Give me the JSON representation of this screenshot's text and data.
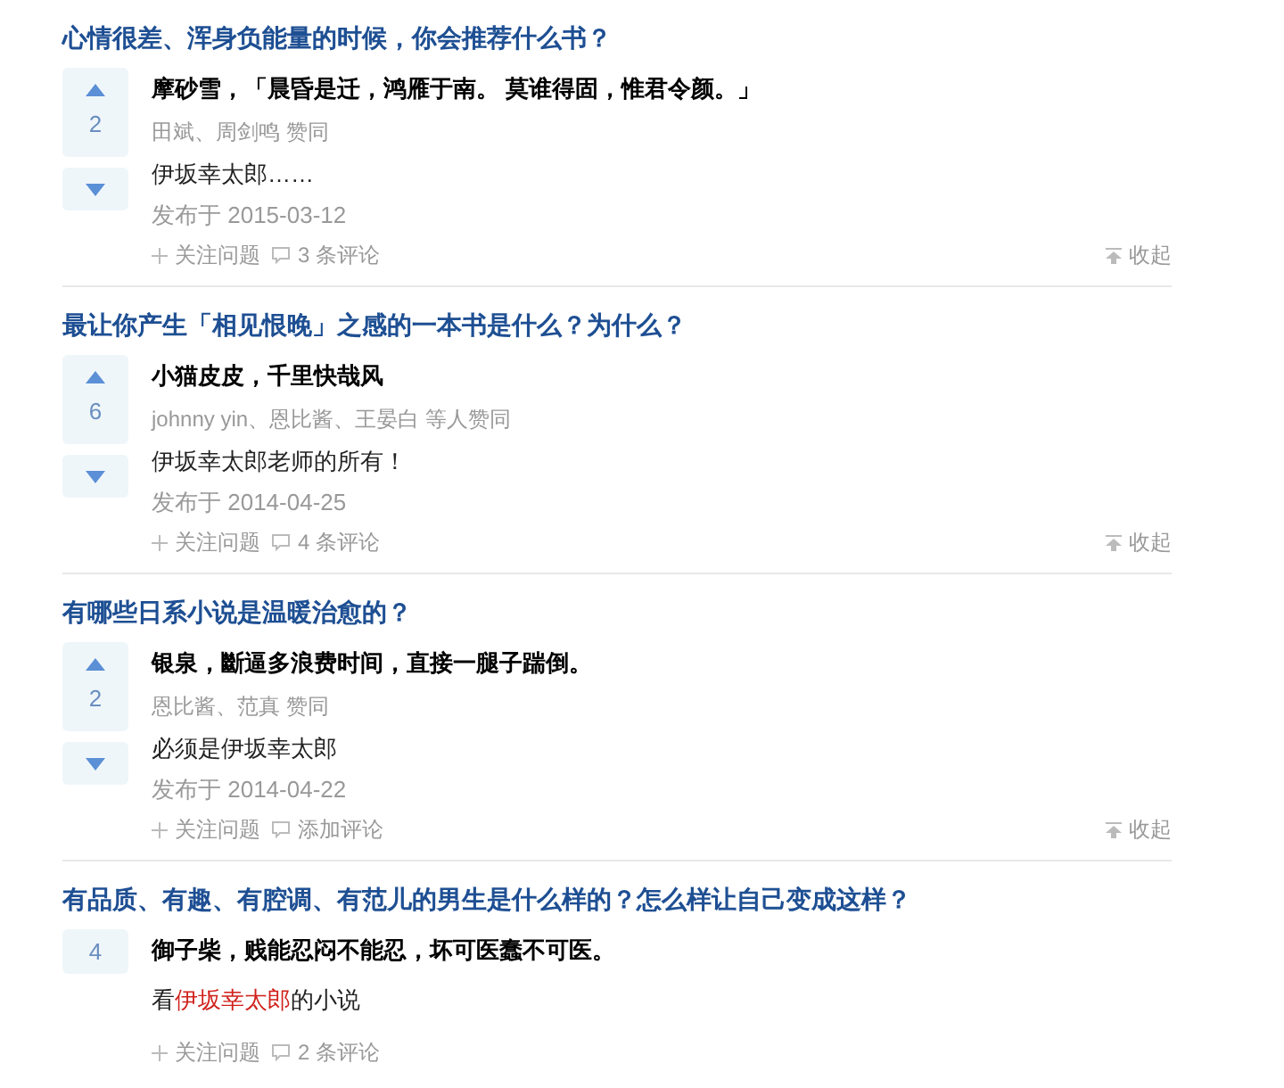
{
  "feed": [
    {
      "question": "心情很差、浑身负能量的时候，你会推荐什么书？",
      "expanded": true,
      "votes": "2",
      "author": "摩砂雪，「晨昏是迁，鸿雁于南。 莫谁得固，惟君令颜。」",
      "voters": "田斌、周剑鸣 赞同",
      "body": [
        {
          "text": "伊坂幸太郎……",
          "highlight": false
        }
      ],
      "date": "发布于 2015-03-12",
      "follow": "关注问题",
      "comments": "3 条评论",
      "collapse": "收起"
    },
    {
      "question": "最让你产生「相见恨晚」之感的一本书是什么？为什么？",
      "expanded": true,
      "votes": "6",
      "author": "小猫皮皮，千里快哉风",
      "voters": "johnny yin、恩比酱、王晏白 等人赞同",
      "body": [
        {
          "text": "伊坂幸太郎老师的所有！",
          "highlight": false
        }
      ],
      "date": "发布于 2014-04-25",
      "follow": "关注问题",
      "comments": "4 条评论",
      "collapse": "收起"
    },
    {
      "question": "有哪些日系小说是温暖治愈的？",
      "expanded": true,
      "votes": "2",
      "author": "银泉，斷逼多浪费时间，直接一腿子踹倒。",
      "voters": "恩比酱、范真 赞同",
      "body": [
        {
          "text": "必须是伊坂幸太郎",
          "highlight": false
        }
      ],
      "date": "发布于 2014-04-22",
      "follow": "关注问题",
      "comments": "添加评论",
      "collapse": "收起"
    },
    {
      "question": "有品质、有趣、有腔调、有范儿的男生是什么样的？怎么样让自己变成这样？",
      "expanded": false,
      "votes": "4",
      "author": "御子柴，贱能忍闷不能忍，坏可医蠢不可医。",
      "body": [
        {
          "text": "看",
          "highlight": false
        },
        {
          "text": "伊坂幸太郎",
          "highlight": true
        },
        {
          "text": "的小说",
          "highlight": false
        }
      ],
      "follow": "关注问题",
      "comments": "2 条评论"
    }
  ]
}
